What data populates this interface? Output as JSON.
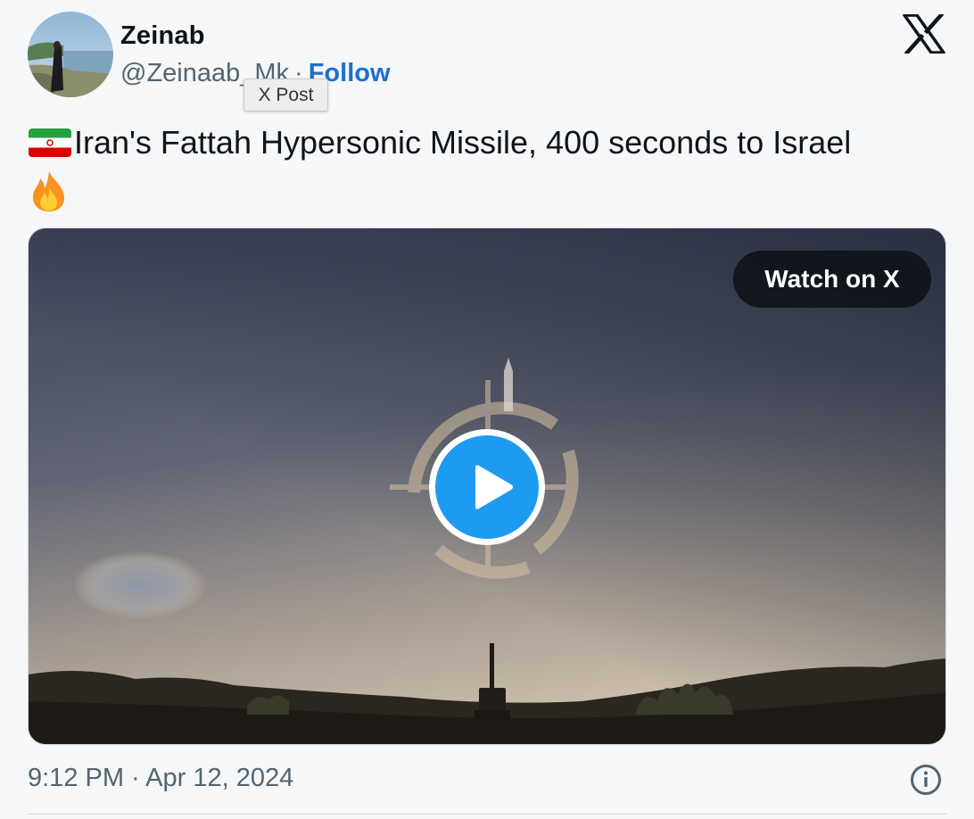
{
  "author": {
    "name": "Zeinab",
    "handle": "@Zeinaab_Mk",
    "separator": "·",
    "follow_label": "Follow"
  },
  "tooltip": {
    "text": "X Post"
  },
  "brand": {
    "logo_icon": "x-logo-icon"
  },
  "tweet": {
    "flag_icon": "iran-flag-icon",
    "text": "Iran's Fattah Hypersonic Missile, 400 seconds to Israel",
    "trailing_icon": "fire-emoji-icon"
  },
  "media": {
    "watch_label": "Watch on X",
    "play_icon": "play-icon",
    "watermark_icon": "channel-logo-watermark-icon"
  },
  "footer": {
    "timestamp": "9:12 PM · Apr 12, 2024",
    "info_icon": "info-icon"
  },
  "colors": {
    "follow_blue": "#1d6fce",
    "play_blue": "#1d9bf0",
    "muted_text": "#536471",
    "pill_bg": "#0f1419"
  }
}
